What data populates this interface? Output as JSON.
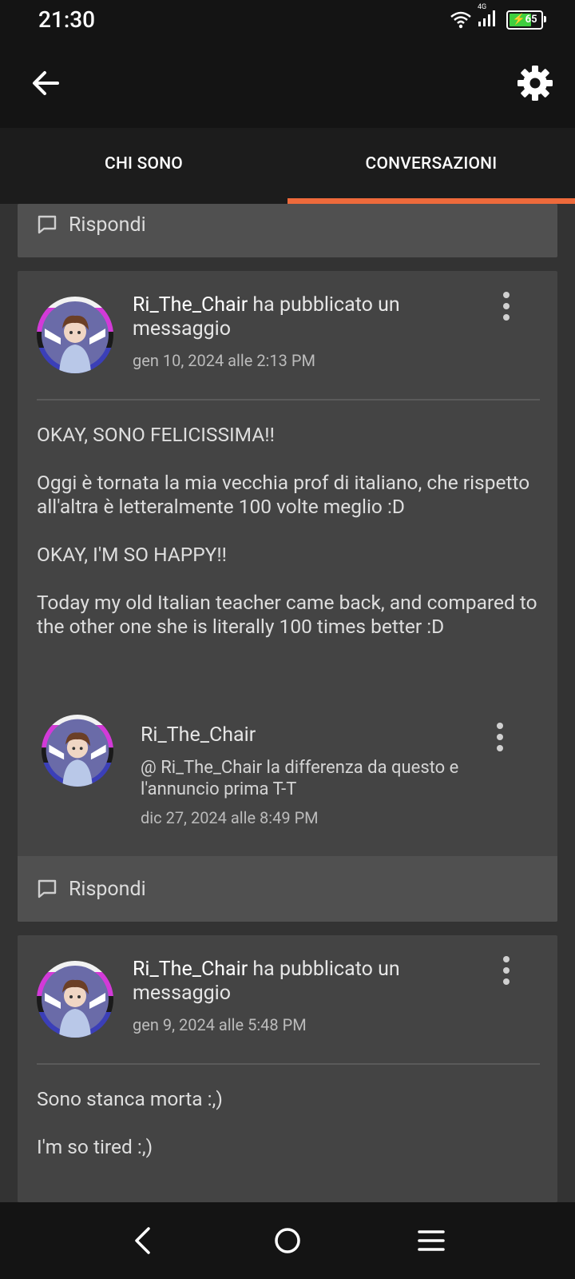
{
  "status": {
    "time": "21:30",
    "network": "4G",
    "battery": "65",
    "battery_level": 0.65
  },
  "appbar": {
    "back_icon": "arrow-left-icon",
    "settings_icon": "gear-icon"
  },
  "tabs": [
    {
      "label": "CHI SONO",
      "active": false
    },
    {
      "label": "CONVERSAZIONI",
      "active": true
    }
  ],
  "colors": {
    "accent": "#ee6a3b",
    "background": "#333333",
    "card": "#444444",
    "reply_bar": "#505050"
  },
  "reply_label": "Rispondi",
  "posts": [
    {
      "user": "Ri_The_Chair",
      "action": " ha pubblicato un messaggio",
      "date": "gen 10, 2024 alle 2:13 PM",
      "paragraphs": [
        "OKAY, SONO FELICISSIMA!!",
        "Oggi è tornata la mia vecchia prof di italiano, che rispetto all'altra è letteralmente 100 volte meglio :D",
        "OKAY, I'M SO HAPPY!!",
        "Today my old Italian teacher came back, and compared to the other one she is literally 100 times better :D"
      ],
      "comment": {
        "user": "Ri_The_Chair",
        "text": "@ Ri_The_Chair  la differenza da questo e l'annuncio prima T-T",
        "date": "dic 27, 2024 alle 8:49 PM"
      }
    },
    {
      "user": "Ri_The_Chair",
      "action": " ha pubblicato un messaggio",
      "date": "gen 9, 2024 alle 5:48 PM",
      "paragraphs": [
        "Sono stanca morta :,)",
        "I'm so tired  :,)"
      ]
    }
  ],
  "navbar": {
    "back_icon": "nav-back-icon",
    "home_icon": "nav-home-icon",
    "menu_icon": "nav-menu-icon"
  }
}
